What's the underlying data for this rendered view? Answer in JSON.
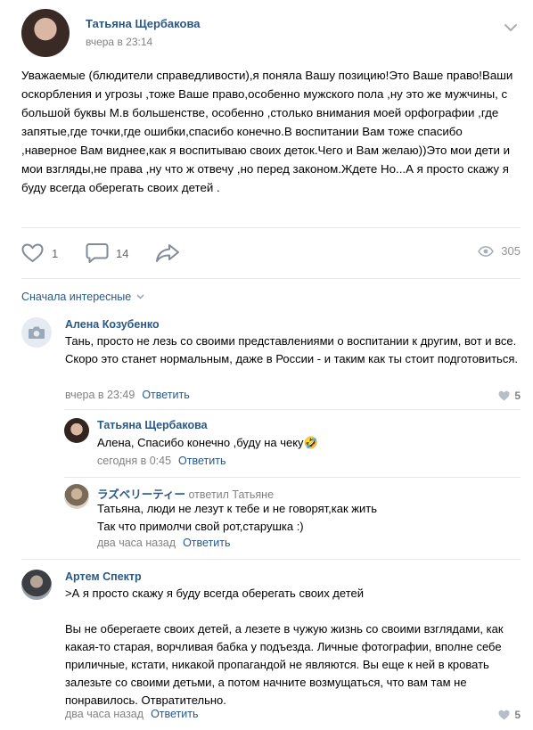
{
  "post": {
    "author": "Татьяна Щербакова",
    "time": "вчера в 23:14",
    "text": "Уважаемые (блюдители справедливости),я поняла Вашу позицию!Это Ваше право!Ваши оскорбления и угрозы ,тоже Ваше право,особенно мужского пола ,ну это же мужчины, с большой буквы М.в большенстве, особенно ,столько внимания моей орфографии ,где запятые,где точки,где ошибки,спасибо конечно.В воспитании Вам тоже спасибо ,наверное Вам виднее,как я воспитываю своих деток.Чего и Вам желаю))Это мои дети и мои взгляды,не права ,ну что ж отвечу ,но перед законом.Ждете Но...А я просто скажу я буду всегда оберегать своих детей .",
    "likes": "1",
    "comments_count": "14",
    "views": "305"
  },
  "sort_label": "Сначала интересные",
  "comments": [
    {
      "author": "Алена Козубенко",
      "text": "Тань, просто не лезь со своими представлениями о воспитании к другим, вот и все. Скоро это станет нормальным, даже в России - и таким как ты стоит подготовиться.",
      "time": "вчера в 23:49",
      "reply_label": "Ответить",
      "likes": "5"
    },
    {
      "author": "Татьяна Щербакова",
      "text": "Алена, Спасибо конечно ,буду на чеку",
      "emoji": "🤣",
      "time": "сегодня в 0:45",
      "reply_label": "Ответить"
    },
    {
      "author": "ラズベリーティー",
      "replied_to": "ответил Татьяне",
      "text": "Татьяна, люди не лезут к тебе и не говорят,как жить\nТак что примолчи свой рот,старушка :)",
      "time": "два часа назад",
      "reply_label": "Ответить"
    },
    {
      "author": "Артем Спектр",
      "text": ">А я просто скажу я буду всегда оберегать своих детей\n\nВы не оберегаете своих детей, а лезете в чужую жизнь со своими взглядами, как какая-то старая, ворчливая бабка у подъезда. Личные фотографии, вполне себе приличные, кстати, никакой пропагандой не являются. Вы еще к ней в кровать залезьте со своими детьми, а потом начните возмущаться, что вам там не понравилось. Отвратительно.",
      "time": "два часа назад",
      "reply_label": "Ответить",
      "likes": "5"
    }
  ]
}
